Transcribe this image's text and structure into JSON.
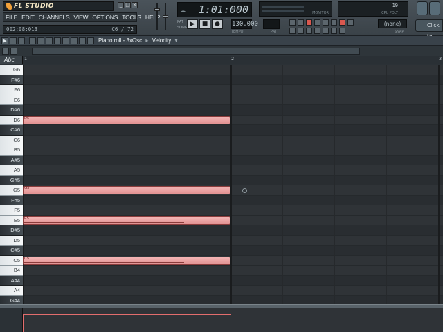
{
  "app": {
    "logo": "FL STUDIO",
    "window_buttons": [
      "_",
      "□",
      "×"
    ]
  },
  "menu": {
    "items": [
      "FILE",
      "EDIT",
      "CHANNELS",
      "VIEW",
      "OPTIONS",
      "TOOLS",
      "HELP"
    ]
  },
  "hint_bar": {
    "time": "002:08:013",
    "note_info": "C6 / 72"
  },
  "transport": {
    "song_position": "1:01:000",
    "tempo": "130.000",
    "tempo_label": "TEMPO",
    "pattern_label": "PAT",
    "song_label": "SONG",
    "pattern_box_label": "PAT",
    "buttons": [
      "▶",
      "■",
      "●"
    ]
  },
  "meters": {
    "monitor_label": "MONITOR",
    "cpu_value": "19",
    "cpu_label": "CPU  POLY"
  },
  "snap": {
    "value": "(none)",
    "label": "SNAP"
  },
  "click_to": "Click to",
  "piano_roll": {
    "title": "Piano roll - 3xOsc",
    "param": "Velocity",
    "abc_label": "Abc",
    "bar_numbers": [
      "1",
      "2",
      "3"
    ]
  },
  "keys": [
    {
      "label": "G6",
      "black": false
    },
    {
      "label": "F#6",
      "black": true
    },
    {
      "label": "F6",
      "black": false
    },
    {
      "label": "E6",
      "black": false
    },
    {
      "label": "D#6",
      "black": true
    },
    {
      "label": "D6",
      "black": false
    },
    {
      "label": "C#6",
      "black": true
    },
    {
      "label": "C6",
      "black": false
    },
    {
      "label": "B5",
      "black": false
    },
    {
      "label": "A#5",
      "black": true
    },
    {
      "label": "A5",
      "black": false
    },
    {
      "label": "G#5",
      "black": true
    },
    {
      "label": "G5",
      "black": false
    },
    {
      "label": "F#5",
      "black": true
    },
    {
      "label": "F5",
      "black": false
    },
    {
      "label": "E5",
      "black": false
    },
    {
      "label": "D#5",
      "black": true
    },
    {
      "label": "D5",
      "black": false
    },
    {
      "label": "C#5",
      "black": true
    },
    {
      "label": "C5",
      "black": false
    },
    {
      "label": "B4",
      "black": false
    },
    {
      "label": "A#4",
      "black": true
    },
    {
      "label": "A4",
      "black": false
    },
    {
      "label": "G#4",
      "black": true
    }
  ],
  "notes": [
    {
      "pitch": "D6",
      "start_bar": 1,
      "length_bars": 1,
      "velocity": 0.78
    },
    {
      "pitch": "G5",
      "start_bar": 1,
      "length_bars": 1,
      "velocity": 0.78
    },
    {
      "pitch": "E5",
      "start_bar": 1,
      "length_bars": 1,
      "velocity": 0.78
    },
    {
      "pitch": "C5",
      "start_bar": 1,
      "length_bars": 1,
      "velocity": 0.78
    }
  ],
  "colors": {
    "note_fill": "#eba3a3",
    "velocity": "#e36d6d",
    "lcd": "#131719"
  }
}
